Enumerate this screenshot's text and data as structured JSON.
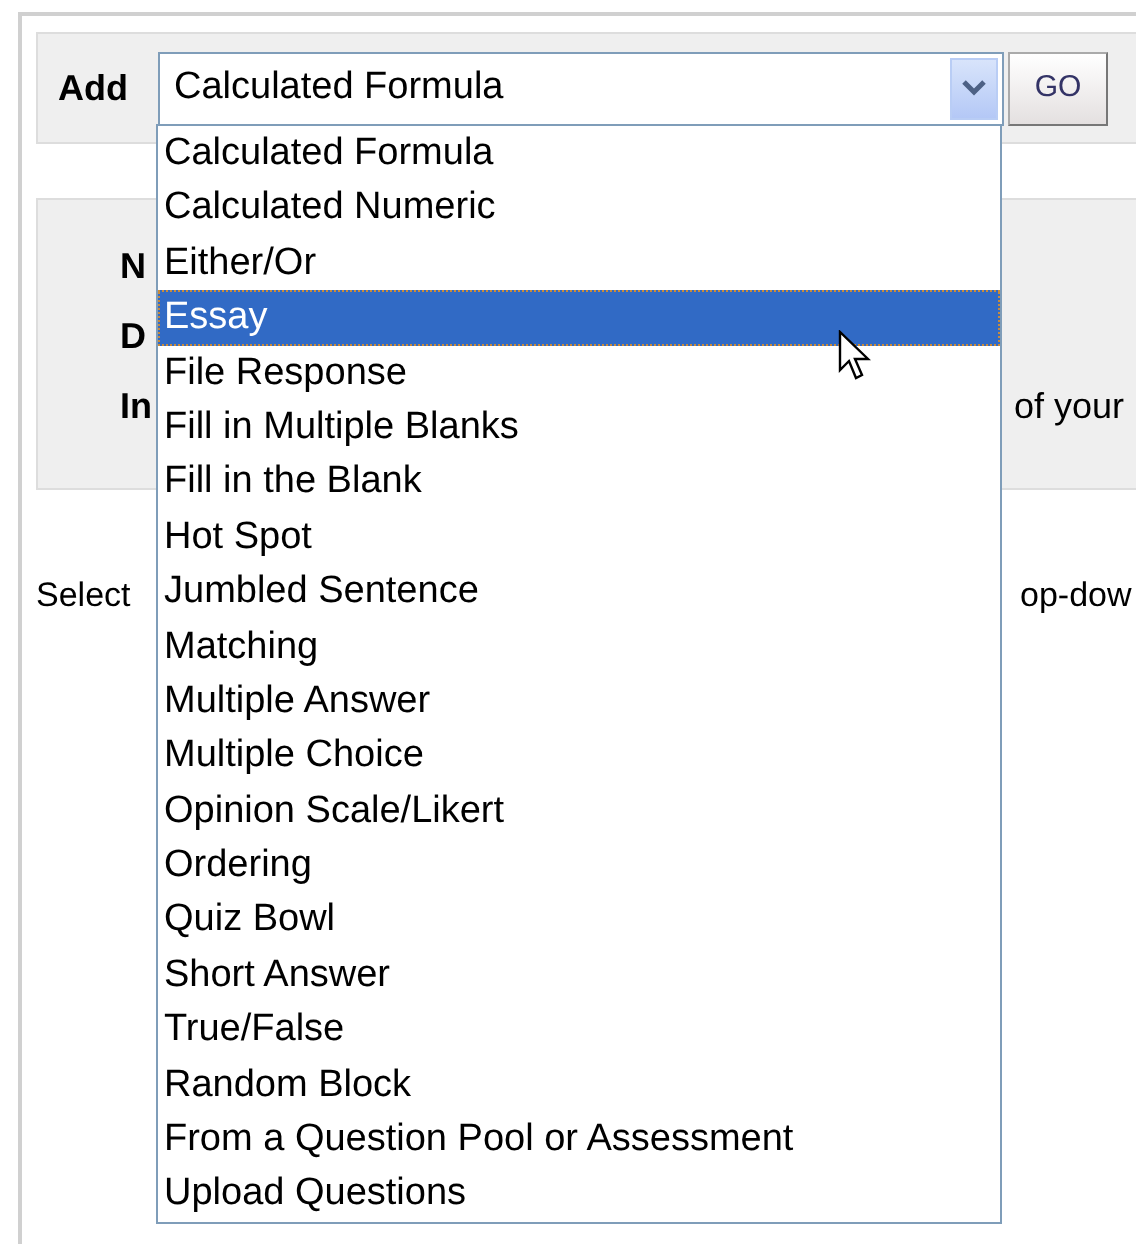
{
  "toolbar": {
    "label": "Add",
    "select": {
      "value": "Calculated Formula",
      "expanded": true
    },
    "button": "GO"
  },
  "dropdown": [
    {
      "label": "Calculated Formula",
      "selected": false
    },
    {
      "label": "Calculated Numeric",
      "selected": false
    },
    {
      "label": "Either/Or",
      "selected": false
    },
    {
      "label": "Essay",
      "selected": true
    },
    {
      "label": "File Response",
      "selected": false
    },
    {
      "label": "Fill in Multiple Blanks",
      "selected": false
    },
    {
      "label": "Fill in the Blank",
      "selected": false
    },
    {
      "label": "Hot Spot",
      "selected": false
    },
    {
      "label": "Jumbled Sentence",
      "selected": false
    },
    {
      "label": "Matching",
      "selected": false
    },
    {
      "label": "Multiple Answer",
      "selected": false
    },
    {
      "label": "Multiple Choice",
      "selected": false
    },
    {
      "label": "Opinion Scale/Likert",
      "selected": false
    },
    {
      "label": "Ordering",
      "selected": false
    },
    {
      "label": "Quiz Bowl",
      "selected": false
    },
    {
      "label": "Short Answer",
      "selected": false
    },
    {
      "label": "True/False",
      "selected": false
    },
    {
      "label": "Random Block",
      "selected": false
    },
    {
      "label": "From a Question Pool or Assessment",
      "selected": false
    },
    {
      "label": "Upload Questions",
      "selected": false
    }
  ],
  "info_panel": [
    {
      "label": "N"
    },
    {
      "label": "D"
    },
    {
      "label": "In",
      "text": "of your"
    }
  ],
  "instructions": {
    "start": "Select",
    "end": "op-dow"
  }
}
